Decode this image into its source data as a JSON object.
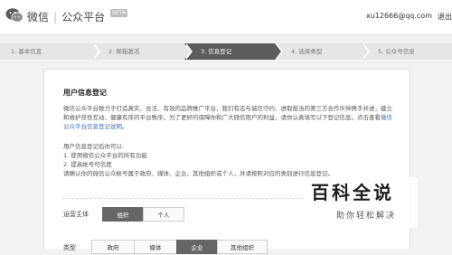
{
  "header": {
    "brand_name": "微信",
    "separator": "|",
    "product": "公众平台",
    "beta": "BETA",
    "email": "xu12666@qq.com",
    "user_label": "退出"
  },
  "steps": [
    {
      "label": "1. 基本信息",
      "active": false
    },
    {
      "label": "2. 邮箱激活",
      "active": false
    },
    {
      "label": "3. 信息登记",
      "active": true
    },
    {
      "label": "4. 选择类型",
      "active": false
    },
    {
      "label": "5. 公众号信息",
      "active": false
    }
  ],
  "form": {
    "title": "用户信息登记",
    "intro_text": "微信公众平台致力于打造真实、合法、有效的品牌推广平台，我们有志与诚信守约、进取担当的第三方合作伙伴携手并进，建立和维护良性互动、健康有序的平台秩序。为了更好的保障你和广大微信用户的利益，请你认真填写以下登记信息。点击查看",
    "intro_link": "微信公众平台信息登记说明",
    "intro_end": "。",
    "perm_title": "用户信息登记后你可以:",
    "perm_1": "1. 使用微信公众平台的所有功能",
    "perm_2": "2. 提高帐号可信度",
    "perm_3": "请确认你的微信公众帐号属于政府、媒体、企业、其他组织或个人，并请按照对应的类别进行信息登记。",
    "subject_label": "运营主体",
    "subject_options": [
      "组织",
      "个人"
    ],
    "subject_selected": "组织",
    "type_label": "类型",
    "type_options": [
      "政府",
      "媒体",
      "企业",
      "其他组织"
    ],
    "type_selected": "企业"
  },
  "watermark": {
    "title": "百科全说",
    "subtitle": "助你轻松解决"
  },
  "colors": {
    "active_step": "#5c5c5c",
    "link": "#3c6fb6",
    "selected_option": "#666666"
  }
}
